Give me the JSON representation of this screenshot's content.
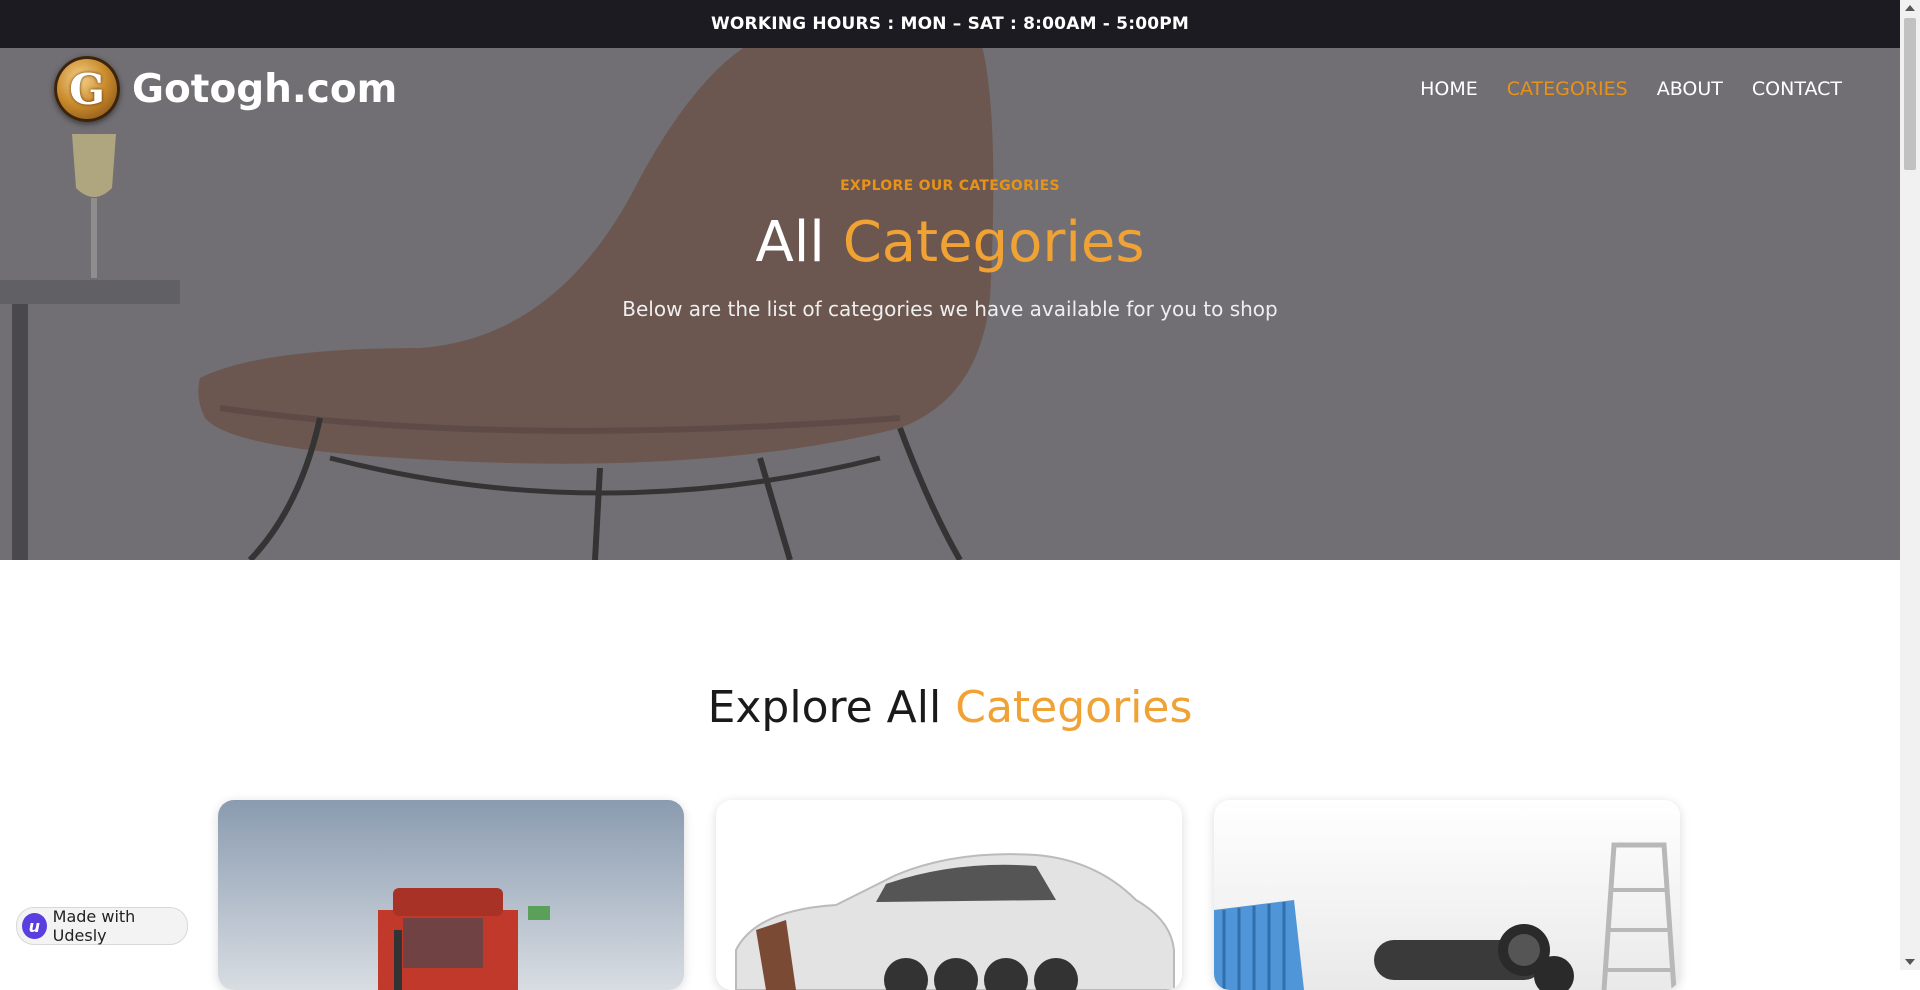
{
  "topbar": {
    "text": "WORKING HOURS : MON – SAT : 8:00AM - 5:00PM"
  },
  "brand": {
    "initial": "G",
    "name": "Gotogh.com"
  },
  "nav": {
    "items": [
      {
        "label": "HOME",
        "active": false
      },
      {
        "label": "CATEGORIES",
        "active": true
      },
      {
        "label": "ABOUT",
        "active": false
      },
      {
        "label": "CONTACT",
        "active": false
      }
    ]
  },
  "hero": {
    "eyebrow": "EXPLORE OUR CATEGORIES",
    "title_plain": "All",
    "title_accent": "Categories",
    "subtitle": "Below are the list of categories we have available for you to shop"
  },
  "section": {
    "title_plain": "Explore All",
    "title_accent": "Categories"
  },
  "badge": {
    "icon_letter": "u",
    "label": "Made with Udesly"
  },
  "colors": {
    "accent": "#e8921a",
    "topbar": "#1c1b22",
    "hero_overlay": "#6e6d71"
  }
}
